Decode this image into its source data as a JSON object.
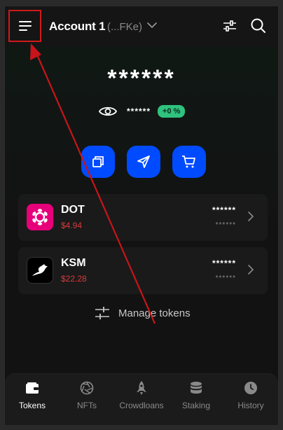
{
  "header": {
    "account_name": "Account 1",
    "account_address": "(...FKe)"
  },
  "balance": {
    "total_masked": "******",
    "sub_masked": "******",
    "change_badge": "+0 %"
  },
  "tokens": [
    {
      "symbol": "DOT",
      "price": "$4.94",
      "balance_masked": "******",
      "value_masked": "******"
    },
    {
      "symbol": "KSM",
      "price": "$22.28",
      "balance_masked": "******",
      "value_masked": "******"
    }
  ],
  "manage_tokens_label": "Manage tokens",
  "tabs": [
    {
      "label": "Tokens",
      "icon": "wallet-icon",
      "active": true
    },
    {
      "label": "NFTs",
      "icon": "aperture-icon",
      "active": false
    },
    {
      "label": "Crowdloans",
      "icon": "rocket-icon",
      "active": false
    },
    {
      "label": "Staking",
      "icon": "database-icon",
      "active": false
    },
    {
      "label": "History",
      "icon": "clock-icon",
      "active": false
    }
  ],
  "colors": {
    "accent_blue": "#004bff",
    "highlight_red": "#d11a1a",
    "positive_green": "#2ec27e",
    "price_red": "#d93a3a",
    "dot_pink": "#e6007a"
  }
}
